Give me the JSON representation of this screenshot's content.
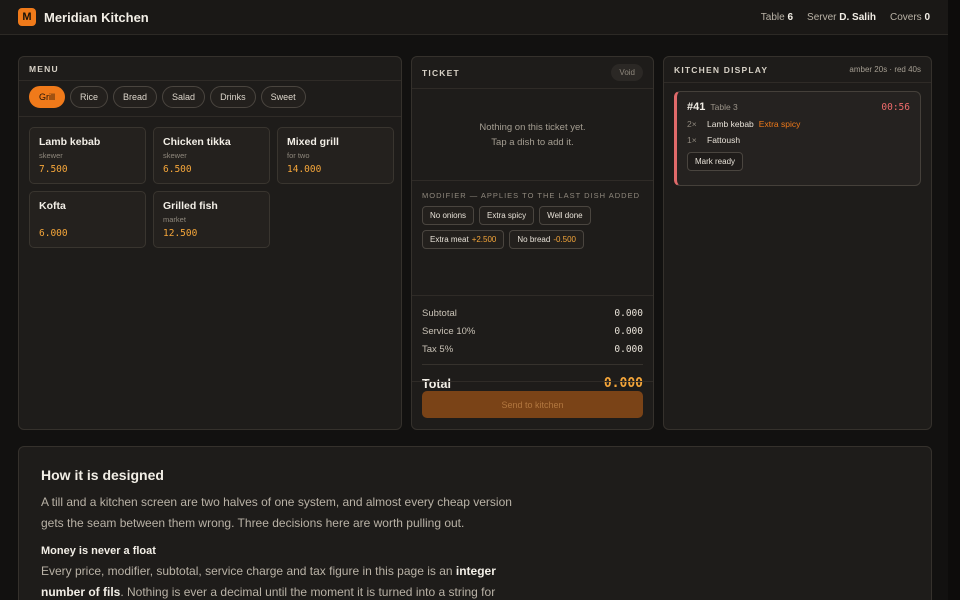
{
  "header": {
    "logo_letter": "M",
    "app_title": "Meridian Kitchen",
    "table_label": "Table",
    "table_value": "6",
    "server_label": "Server",
    "server_value": "D. Salih",
    "covers_label": "Covers",
    "covers_value": "0"
  },
  "menu": {
    "title": "MENU",
    "categories": [
      {
        "label": "Grill",
        "active": true
      },
      {
        "label": "Rice",
        "active": false
      },
      {
        "label": "Bread",
        "active": false
      },
      {
        "label": "Salad",
        "active": false
      },
      {
        "label": "Drinks",
        "active": false
      },
      {
        "label": "Sweet",
        "active": false
      }
    ],
    "dishes": [
      {
        "name": "Lamb kebab",
        "sub": "skewer",
        "price": "7.500"
      },
      {
        "name": "Chicken tikka",
        "sub": "skewer",
        "price": "6.500"
      },
      {
        "name": "Mixed grill",
        "sub": "for two",
        "price": "14.000"
      },
      {
        "name": "Kofta",
        "sub": "",
        "price": "6.000"
      },
      {
        "name": "Grilled fish",
        "sub": "market",
        "price": "12.500"
      }
    ]
  },
  "ticket": {
    "title": "TICKET",
    "void_label": "Void",
    "empty_line1": "Nothing on this ticket yet.",
    "empty_line2": "Tap a dish to add it.",
    "modifier_title": "MODIFIER — APPLIES TO THE LAST DISH ADDED",
    "modifiers": [
      {
        "label": "No onions",
        "delta": ""
      },
      {
        "label": "Extra spicy",
        "delta": ""
      },
      {
        "label": "Well done",
        "delta": ""
      },
      {
        "label": "Extra meat",
        "delta": "+2.500"
      },
      {
        "label": "No bread",
        "delta": "-0.500"
      }
    ],
    "subtotal_label": "Subtotal",
    "subtotal_value": "0.000",
    "service_label": "Service 10%",
    "service_value": "0.000",
    "tax_label": "Tax 5%",
    "tax_value": "0.000",
    "total_label": "Total",
    "total_value": "0.000",
    "send_label": "Send to kitchen"
  },
  "kitchen": {
    "title": "KITCHEN DISPLAY",
    "legend": "amber 20s · red 40s",
    "order": {
      "number": "#41",
      "table": "Table 3",
      "timer": "00:56",
      "lines": [
        {
          "qty": "2×",
          "name": "Lamb kebab",
          "mod": "Extra spicy"
        },
        {
          "qty": "1×",
          "name": "Fattoush",
          "mod": ""
        }
      ],
      "ready_label": "Mark ready"
    }
  },
  "explain": {
    "title": "How it is designed",
    "intro": "A till and a kitchen screen are two halves of one system, and almost every cheap version gets the seam between them wrong. Three decisions here are worth pulling out.",
    "sub1": "Money is never a float",
    "p1_a": "Every price, modifier, subtotal, service charge and tax figure in this page is an ",
    "p1_b": "integer number of fils",
    "p1_c": ". Nothing is ever a decimal until the moment it is turned into a string for"
  },
  "colors": {
    "accent": "#f07a1a",
    "price": "#f5a63a",
    "alert": "#ef6b6b"
  }
}
